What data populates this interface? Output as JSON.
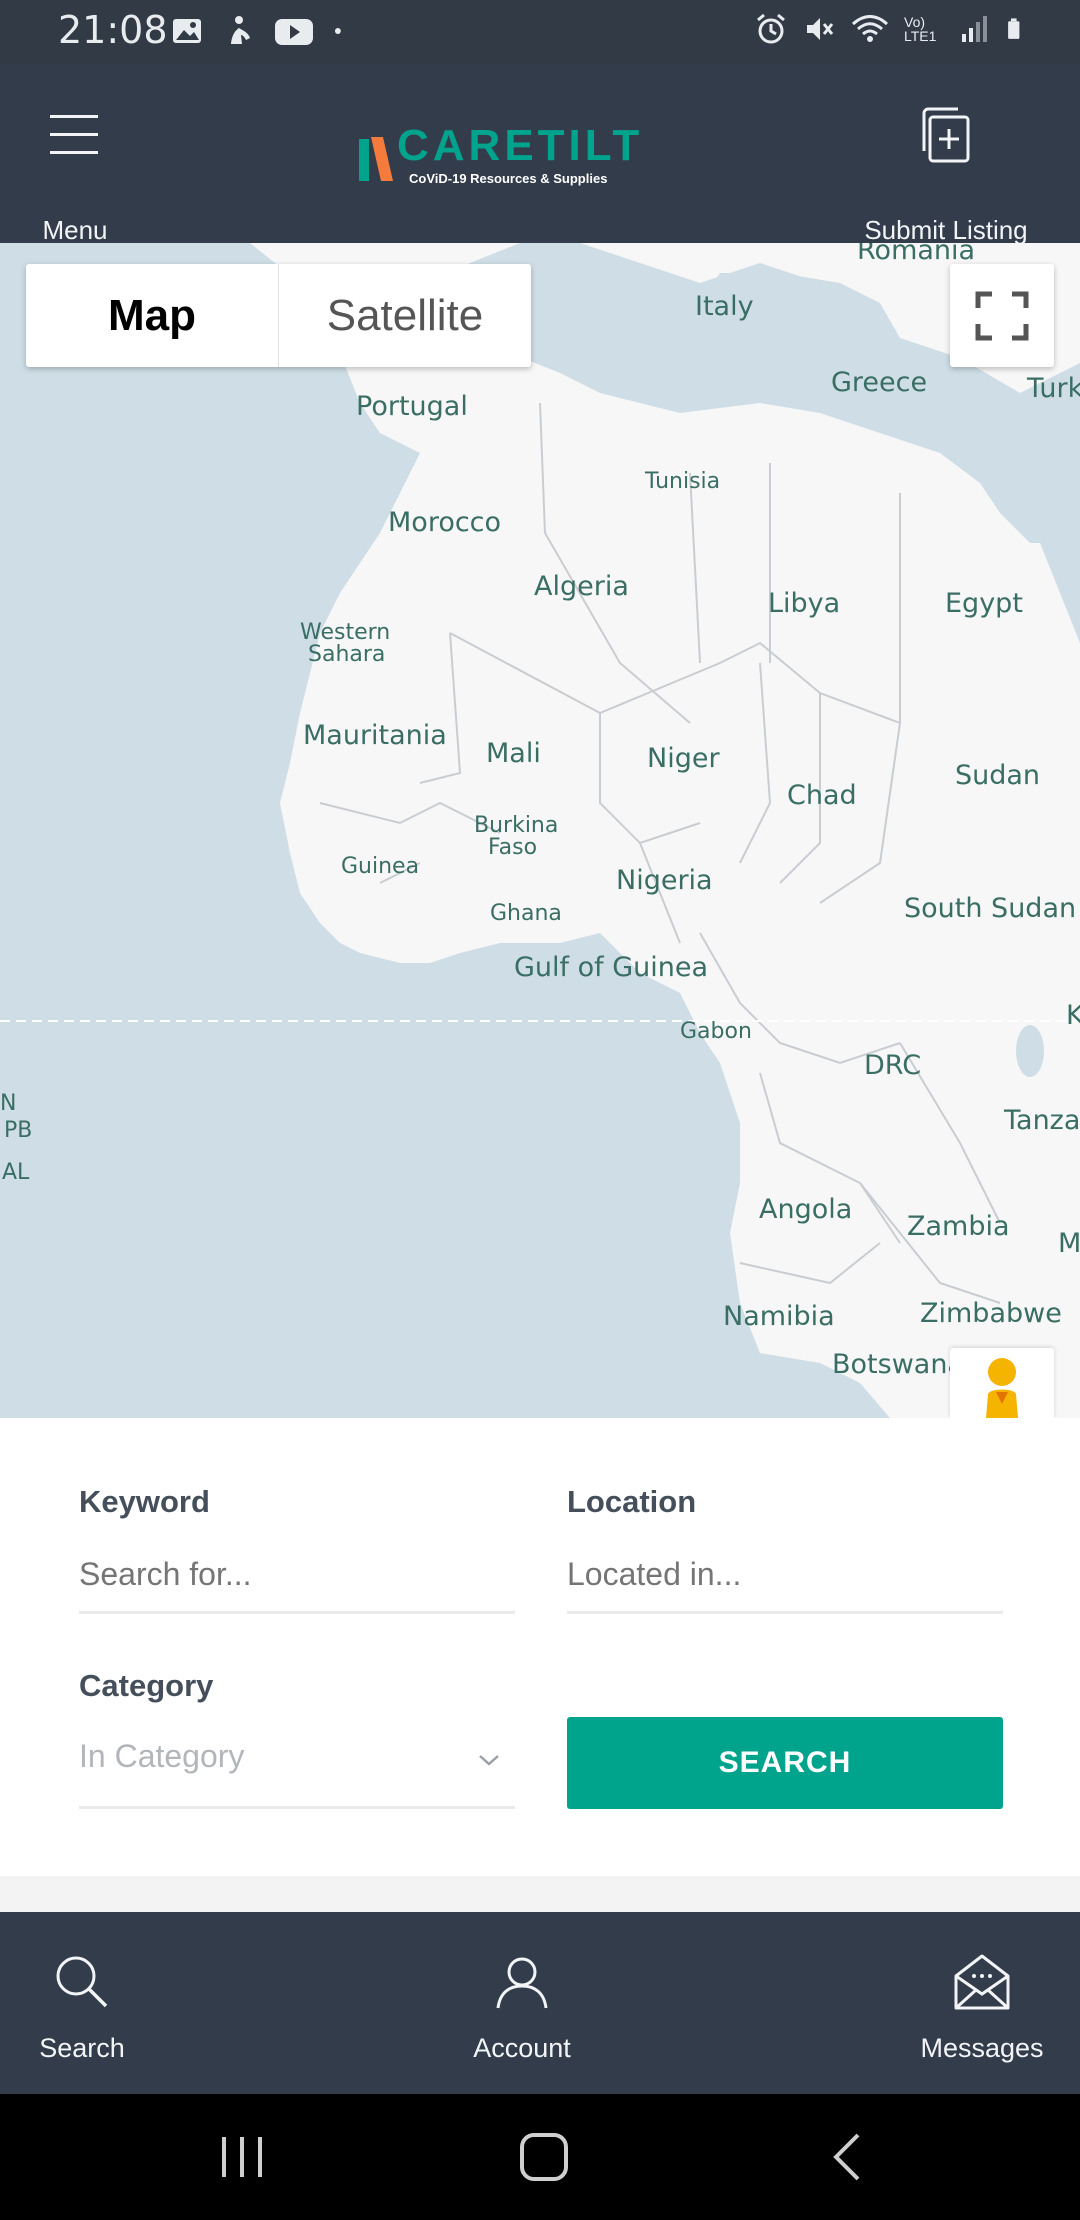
{
  "status_bar": {
    "time": "21:08",
    "left_icons": [
      "image-icon",
      "accessibility-icon",
      "youtube-icon",
      "dot-icon"
    ],
    "right_icons": [
      "alarm-icon",
      "mute-icon",
      "wifi-icon",
      "volte-icon",
      "signal-icon",
      "battery-icon"
    ],
    "volte_text": "Vo) LTE1"
  },
  "header": {
    "menu_label": "Menu",
    "logo_text": "CARETILT",
    "logo_tagline": "CoViD-19 Resources & Supplies",
    "submit_label": "Submit Listing"
  },
  "map": {
    "tabs": [
      "Map",
      "Satellite"
    ],
    "active_tab": "Map",
    "labels": {
      "romania": "Romania",
      "italy": "Italy",
      "greece": "Greece",
      "turk": "Turk",
      "portugal": "Portugal",
      "tunisia": "Tunisia",
      "morocco": "Morocco",
      "algeria": "Algeria",
      "libya": "Libya",
      "egypt": "Egypt",
      "western_sahara_1": "Western",
      "western_sahara_2": "Sahara",
      "mauritania": "Mauritania",
      "mali": "Mali",
      "niger": "Niger",
      "chad": "Chad",
      "sudan": "Sudan",
      "burkina_1": "Burkina",
      "burkina_2": "Faso",
      "guinea": "Guinea",
      "nigeria": "Nigeria",
      "ghana": "Ghana",
      "south_sudan": "South Sudan",
      "gulf": "Gulf of Guinea",
      "gabon": "Gabon",
      "drc": "DRC",
      "tanza": "Tanza",
      "k": "K",
      "angola": "Angola",
      "zambia": "Zambia",
      "m": "M",
      "namibia": "Namibia",
      "zimbabwe": "Zimbabwe",
      "botswana": "Botswana",
      "n": "N",
      "pb": "PB",
      "al": "AL"
    },
    "accent_land": "#f7f7f7",
    "accent_water": "#cfdee6"
  },
  "search_form": {
    "keyword_label": "Keyword",
    "keyword_placeholder": "Search for...",
    "location_label": "Location",
    "location_placeholder": "Located in...",
    "category_label": "Category",
    "category_value": "In Category",
    "search_button": "SEARCH",
    "accent": "#00a48d"
  },
  "bottom_nav": {
    "search": "Search",
    "account": "Account",
    "messages": "Messages"
  }
}
